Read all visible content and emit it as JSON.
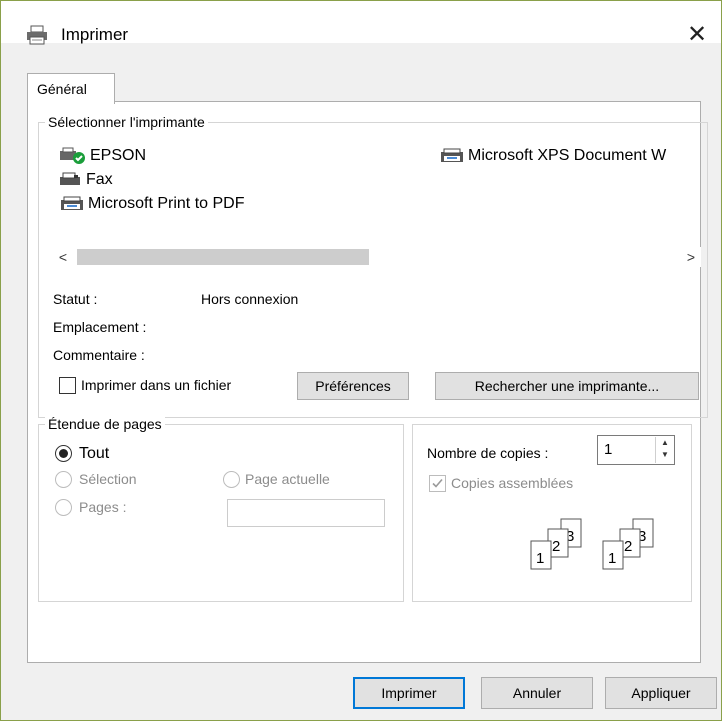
{
  "window": {
    "title": "Imprimer",
    "close_glyph": "✕"
  },
  "tabs": [
    {
      "label": "Général",
      "active": true
    }
  ],
  "select_printer": {
    "title": "Sélectionner l'imprimante",
    "printers": [
      {
        "name": "EPSON",
        "icon": "printer-default-icon"
      },
      {
        "name": "Microsoft XPS Document W",
        "icon": "printer-icon"
      },
      {
        "name": "Fax",
        "icon": "fax-icon"
      },
      {
        "name": "Microsoft Print to PDF",
        "icon": "printer-icon"
      }
    ],
    "scroll_left": "<",
    "scroll_right": ">",
    "status_label": "Statut :",
    "status_value": "Hors connexion",
    "location_label": "Emplacement :",
    "comment_label": "Commentaire :",
    "print_to_file_label": "Imprimer dans un fichier",
    "print_to_file_checked": false,
    "preferences_button": "Préférences",
    "find_printer_button": "Rechercher une imprimante..."
  },
  "page_range": {
    "title": "Étendue de pages",
    "all_label": "Tout",
    "selection_label": "Sélection",
    "current_page_label": "Page actuelle",
    "pages_label": "Pages :",
    "pages_value": "",
    "selected": "all"
  },
  "copies": {
    "count_label": "Nombre de copies :",
    "count_value": "1",
    "collate_label": "Copies assemblées",
    "collate_checked": true
  },
  "buttons": {
    "print": "Imprimer",
    "cancel": "Annuler",
    "apply": "Appliquer"
  },
  "colors": {
    "accent": "#0078d7",
    "window_border": "#8aa04a"
  }
}
